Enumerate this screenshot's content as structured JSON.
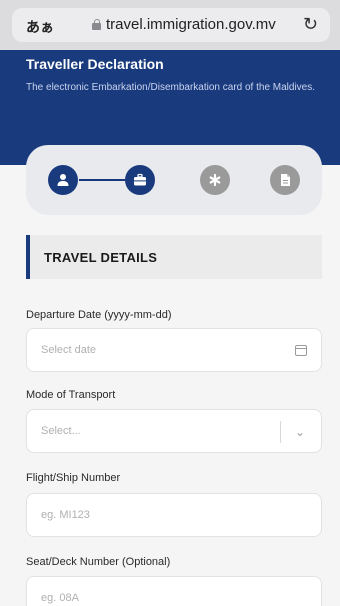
{
  "browser": {
    "aa_label": "あぁ",
    "url": "travel.immigration.gov.mv",
    "reload_glyph": "↻"
  },
  "header": {
    "title": "Traveller Declaration",
    "subtitle": "The electronic Embarkation/Disembarkation card of the Maldives."
  },
  "stepper": {
    "steps": [
      {
        "icon": "person-icon",
        "state": "active"
      },
      {
        "icon": "briefcase-icon",
        "state": "active"
      },
      {
        "icon": "asterisk-icon",
        "state": "inactive"
      },
      {
        "icon": "document-icon",
        "state": "inactive"
      }
    ]
  },
  "section": {
    "title": "TRAVEL DETAILS"
  },
  "form": {
    "departure_label": "Departure Date (yyyy-mm-dd)",
    "departure_placeholder": "Select date",
    "transport_label": "Mode of Transport",
    "transport_placeholder": "Select...",
    "flight_label": "Flight/Ship Number",
    "flight_placeholder": "eg. MI123",
    "seat_label": "Seat/Deck Number (Optional)",
    "seat_placeholder": "eg. 08A"
  },
  "colors": {
    "brand": "#1a3a7e",
    "inactive_step": "#9a9a9a",
    "page_bg": "#f5f5f5"
  }
}
